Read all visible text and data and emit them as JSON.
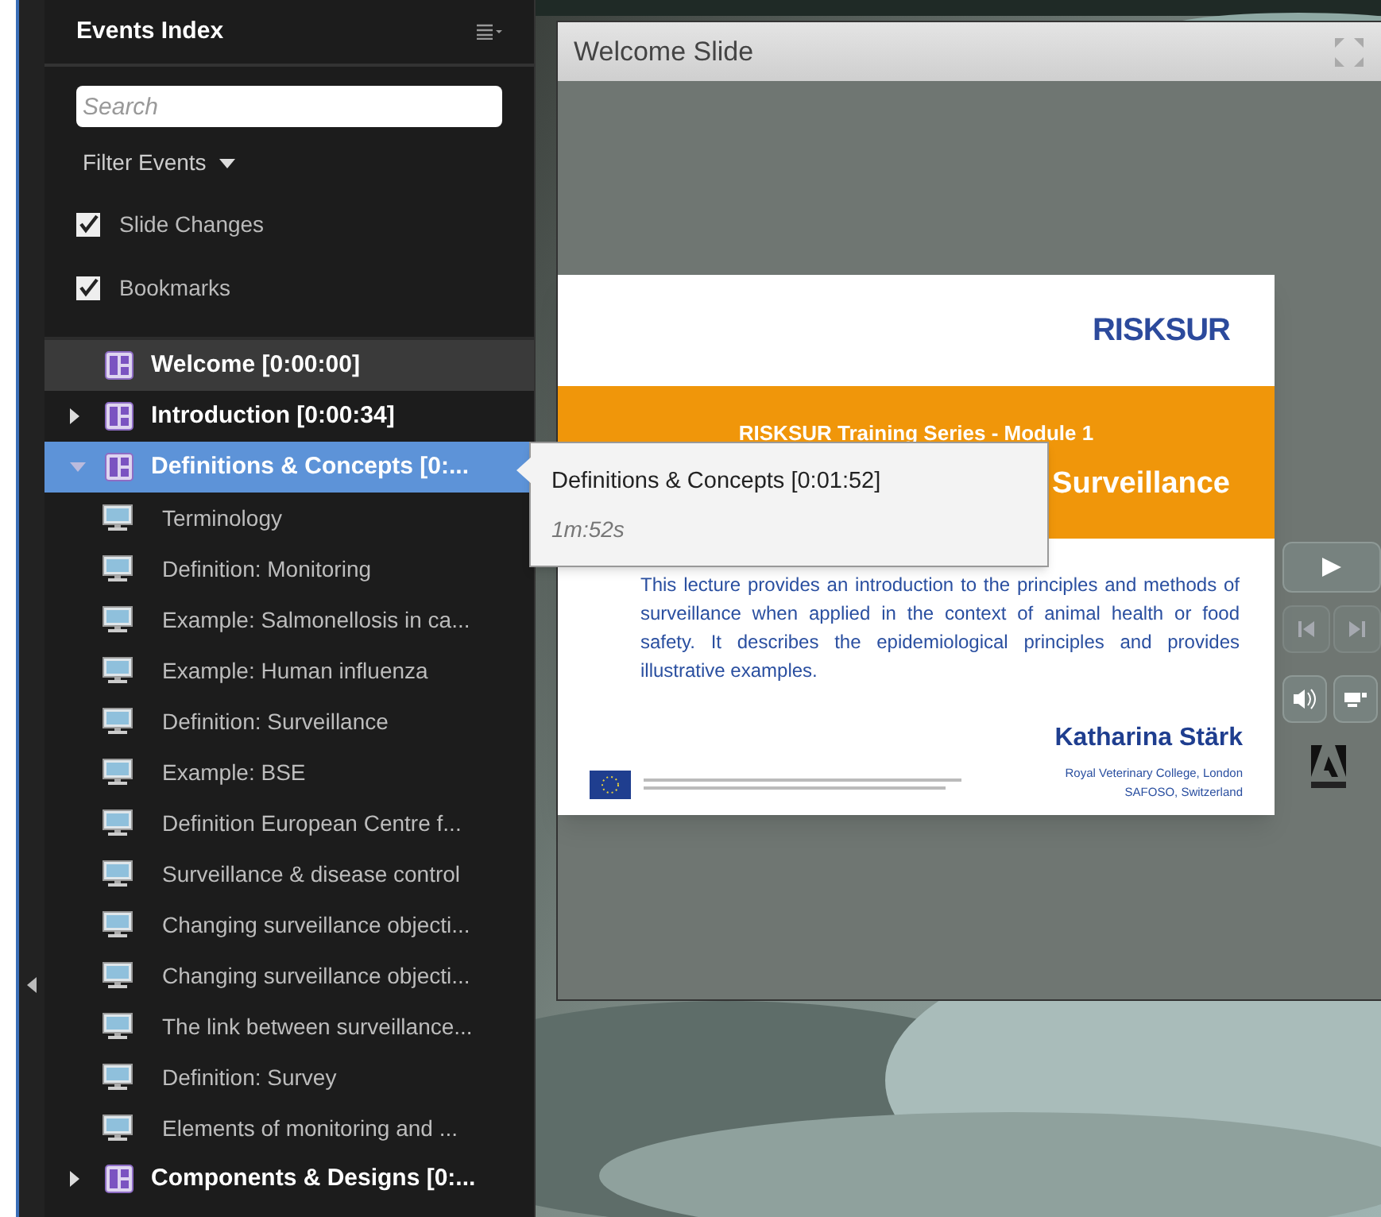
{
  "sidebar": {
    "title": "Events Index",
    "search": {
      "placeholder": "Search"
    },
    "filter_label": "Filter Events",
    "filters": [
      {
        "label": "Slide Changes",
        "checked": true
      },
      {
        "label": "Bookmarks",
        "checked": true
      }
    ],
    "events": [
      {
        "label": "Welcome [0:00:00]",
        "current": true,
        "selected": false
      },
      {
        "label": "Introduction [0:00:34]",
        "current": false,
        "selected": false,
        "expanded": false
      },
      {
        "label": "Definitions & Concepts [0:...",
        "current": false,
        "selected": true,
        "expanded": true,
        "children": [
          {
            "label": "Terminology"
          },
          {
            "label": "Definition: Monitoring"
          },
          {
            "label": "Example: Salmonellosis in ca..."
          },
          {
            "label": "Example: Human influenza"
          },
          {
            "label": "Definition: Surveillance"
          },
          {
            "label": "Example: BSE"
          },
          {
            "label": "Definition European Centre f..."
          },
          {
            "label": "Surveillance & disease control"
          },
          {
            "label": "Changing surveillance objecti..."
          },
          {
            "label": "Changing surveillance objecti..."
          },
          {
            "label": "The link between surveillance..."
          },
          {
            "label": "Definition: Survey"
          },
          {
            "label": "Elements of monitoring and ..."
          }
        ]
      },
      {
        "label": "Components & Designs [0:...",
        "current": false,
        "selected": false,
        "expanded": false
      }
    ]
  },
  "tooltip": {
    "title": "Definitions & Concepts [0:01:52]",
    "duration": "1m:52s"
  },
  "panel": {
    "title": "Welcome Slide",
    "slide": {
      "logo": "RISKSUR",
      "series": "RISKSUR Training Series - Module 1",
      "title": "Surveillance",
      "abstract": "This lecture provides an introduction to the principles and methods of surveillance when applied in the context of animal health or food safety. It describes the epidemiological principles and provides illustrative examples.",
      "author": "Katharina Stärk",
      "affiliations": [
        "Royal Veterinary College, London",
        "SAFOSO, Switzerland"
      ]
    },
    "controls": {
      "prev_disabled": true,
      "next_disabled": true
    }
  }
}
